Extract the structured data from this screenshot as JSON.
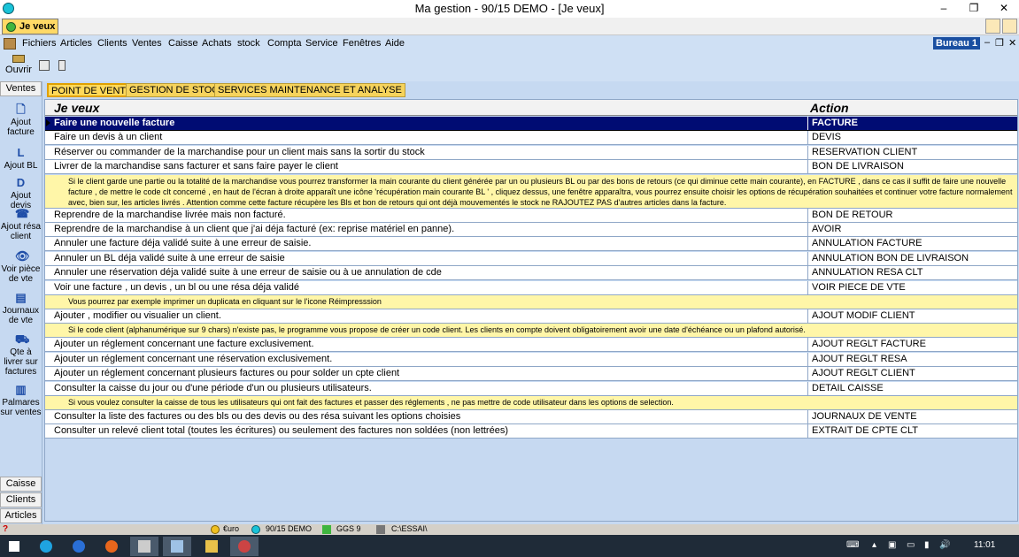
{
  "window": {
    "title": "Ma gestion - 90/15 DEMO - [Je veux]",
    "minimize": "–",
    "restore": "❐",
    "close": "✕"
  },
  "doc_tab": {
    "label": "Je veux"
  },
  "menu": {
    "items": [
      "Fichiers",
      "Articles",
      "Clients",
      "Ventes",
      "Caisse",
      "Achats",
      "stock",
      "Compta",
      "Service",
      "Fenêtres",
      "Aide"
    ],
    "bureau": "Bureau 1",
    "mdi_min": "–",
    "mdi_restore": "❐",
    "mdi_close": "✕"
  },
  "toolbar": {
    "open_label": "Ouvrir"
  },
  "sidebar": {
    "header": "Ventes",
    "items": [
      {
        "label": "Ajout facture",
        "icon": "document-icon",
        "glyph": "🗋"
      },
      {
        "label": "Ajout BL",
        "icon": "letter-l-icon",
        "glyph": "L"
      },
      {
        "label": "Ajout devis",
        "icon": "letter-d-icon",
        "glyph": "D"
      },
      {
        "label": "Ajout résa client",
        "icon": "reservation-icon",
        "glyph": "☎"
      },
      {
        "label": "Voir pièce de vte",
        "icon": "eye-icon",
        "glyph": "👁"
      },
      {
        "label": "Journaux de vte",
        "icon": "journal-icon",
        "glyph": "▤"
      },
      {
        "label": "Qte à livrer sur factures",
        "icon": "truck-icon",
        "glyph": "⛟"
      },
      {
        "label": "Palmares sur ventes",
        "icon": "chart-icon",
        "glyph": "▥"
      }
    ],
    "footer": [
      "Caisse",
      "Clients",
      "Articles"
    ]
  },
  "tabs": [
    "POINT DE VENTE",
    "GESTION DE STOCK",
    "SERVICES  MAINTENANCE ET ANALYSE"
  ],
  "grid": {
    "col_want": "Je veux",
    "col_action": "Action",
    "rows": [
      {
        "type": "row",
        "want": "Faire une nouvelle facture",
        "action": "FACTURE",
        "selected": true
      },
      {
        "type": "row",
        "want": "Faire un devis à un client",
        "action": "DEVIS"
      },
      {
        "type": "row",
        "want": "Réserver ou commander de la marchandise pour un client mais sans la sortir du stock",
        "action": "RESERVATION CLIENT"
      },
      {
        "type": "row",
        "want": "Livrer de la marchandise sans facturer et sans faire payer le client",
        "action": "BON DE LIVRAISON"
      },
      {
        "type": "note",
        "text": "Si le client garde une partie ou la totalité de la marchandise vous pourrez transformer la main courante du client générée par un ou plusieurs BL ou par des bons de retours (ce qui diminue cette main courante), en FACTURE , dans ce cas il suffit de faire une nouvelle facture , de mettre le code clt concerné , en haut de l'écran à droite apparaît une icône 'récupération main courante BL ' , cliquez dessus, une fenêtre apparaîtra, vous pourrez ensuite choisir les options de récupération souhaitées et continuer votre facture normalement avec, bien sur,  les articles  livrés . Attention comme cette facture récupère les Bls et bon de retours qui ont déjà mouvementés le stock ne RAJOUTEZ PAS d'autres articles dans la facture."
      },
      {
        "type": "row",
        "want": "Reprendre de la marchandise livrée mais non facturé.",
        "action": "BON DE RETOUR"
      },
      {
        "type": "row",
        "want": "Reprendre de la marchandise à un client que j'ai déja facturé (ex: reprise matériel en panne).",
        "action": "AVOIR"
      },
      {
        "type": "row",
        "want": "Annuler une facture déja validé suite à une erreur de saisie.",
        "action": "ANNULATION FACTURE"
      },
      {
        "type": "row",
        "want": "Annuler un BL déja validé suite à une erreur de saisie",
        "action": "ANNULATION BON DE LIVRAISON"
      },
      {
        "type": "row",
        "want": "Annuler une réservation déja validé suite à une erreur de saisie ou à ue annulation de cde",
        "action": "ANNULATION RESA CLT"
      },
      {
        "type": "row",
        "want": "Voir une facture , un devis , un bl ou une résa déja validé",
        "action": "VOIR PIECE DE VTE"
      },
      {
        "type": "note",
        "text": "Vous pourrez par exemple imprimer un duplicata en cliquant sur le l'icone Réimpresssion"
      },
      {
        "type": "row",
        "want": "Ajouter , modifier ou visualier un client.",
        "action": "AJOUT MODIF CLIENT"
      },
      {
        "type": "note",
        "text": "Si le code client (alphanumérique sur 9 chars) n'existe pas, le programme vous propose de créer un code client. Les clients en compte doivent obligatoirement avoir une date d'échéance ou un plafond autorisé."
      },
      {
        "type": "row",
        "want": "Ajouter un réglement concernant une facture exclusivement.",
        "action": "AJOUT REGLT FACTURE"
      },
      {
        "type": "row",
        "want": "Ajouter un réglement concernant une réservation exclusivement.",
        "action": "AJOUT REGLT RESA"
      },
      {
        "type": "row",
        "want": "Ajouter un réglement concernant plusieurs factures ou pour solder un cpte client",
        "action": "AJOUT REGLT CLIENT"
      },
      {
        "type": "row",
        "want": "Consulter la caisse du jour ou d'une période d'un ou plusieurs utilisateurs.",
        "action": "DETAIL CAISSE"
      },
      {
        "type": "note",
        "text": "Si vous voulez consulter la caisse de tous les utilisateurs qui ont fait des factures et passer des réglements , ne pas mettre de code utilisateur dans les options de selection."
      },
      {
        "type": "row",
        "want": "Consulter la liste des factures ou des bls ou des devis ou des résa suivant les options choisies",
        "action": "JOURNAUX DE VENTE"
      },
      {
        "type": "row",
        "want": "Consulter un relevé client total (toutes les écritures)  ou seulement des factures non soldées (non lettrées)",
        "action": "EXTRAIT DE CPTE CLT"
      }
    ]
  },
  "statusbar": {
    "help": "?",
    "currency": "€uro",
    "company": "90/15 DEMO",
    "user": "GGS 9",
    "path": "C:\\ESSAI\\"
  },
  "taskbar": {
    "time": "11:01"
  }
}
